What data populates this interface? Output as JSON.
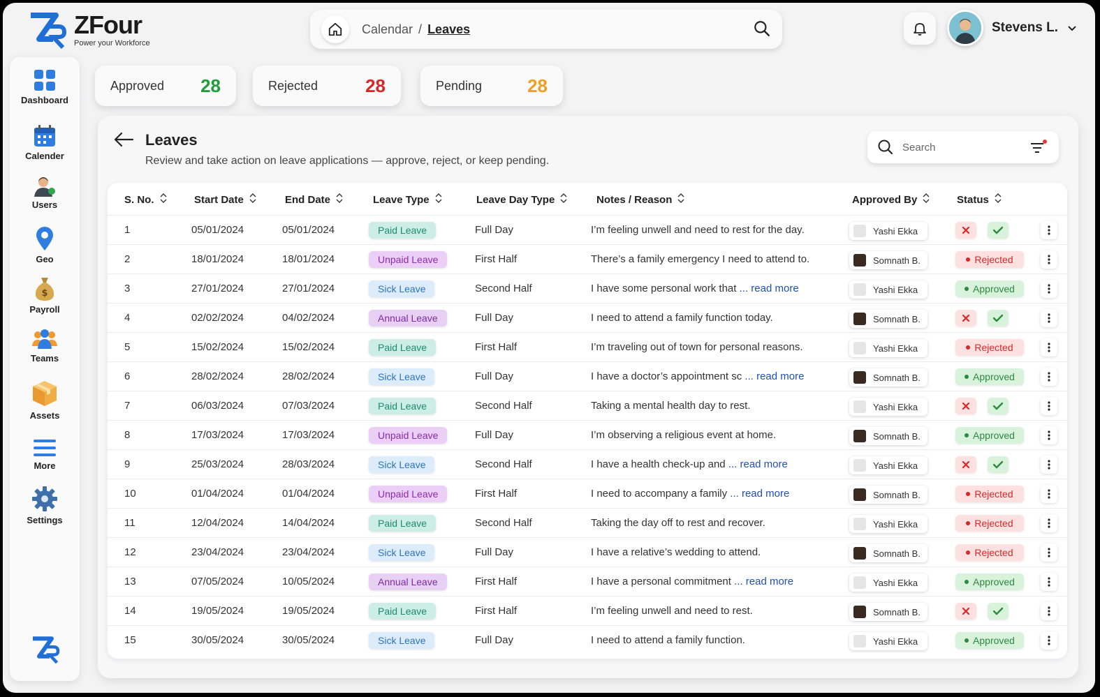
{
  "brand": {
    "name": "ZFour",
    "tagline": "Power your Workforce"
  },
  "breadcrumb": {
    "parent": "Calendar",
    "separator": "/",
    "current": "Leaves"
  },
  "user": {
    "name": "Stevens L."
  },
  "sidebar": {
    "items": [
      {
        "label": "Dashboard",
        "icon": "dashboard-icon"
      },
      {
        "label": "Calender",
        "icon": "calendar-icon"
      },
      {
        "label": "Users",
        "icon": "users-icon"
      },
      {
        "label": "Geo",
        "icon": "geo-pin-icon"
      },
      {
        "label": "Payroll",
        "icon": "money-bag-icon"
      },
      {
        "label": "Teams",
        "icon": "teams-icon"
      },
      {
        "label": "Assets",
        "icon": "box-icon"
      },
      {
        "label": "More",
        "icon": "menu-icon"
      },
      {
        "label": "Settings",
        "icon": "gear-icon"
      }
    ]
  },
  "stats": [
    {
      "label": "Approved",
      "value": "28",
      "color": "#1f9d3a"
    },
    {
      "label": "Rejected",
      "value": "28",
      "color": "#d62828"
    },
    {
      "label": "Pending",
      "value": "28",
      "color": "#f0a020"
    }
  ],
  "panel": {
    "title": "Leaves",
    "subtitle": "Review and take action on leave applications — approve, reject, or keep pending.",
    "search_placeholder": "Search"
  },
  "table": {
    "columns": [
      "S. No.",
      "Start Date",
      "End Date",
      "Leave Type",
      "Leave Day Type",
      "Notes / Reason",
      "Approved By",
      "Status"
    ],
    "rows": [
      {
        "no": "1",
        "start": "05/01/2024",
        "end": "05/01/2024",
        "type": "Paid Leave",
        "type_class": "paid",
        "day": "Full Day",
        "note": "I’m feeling unwell and need to rest for the day.",
        "more": "",
        "approver": "Yashi Ekka",
        "avatar": "light",
        "status": "pending"
      },
      {
        "no": "2",
        "start": "18/01/2024",
        "end": "18/01/2024",
        "type": "Unpaid Leave",
        "type_class": "unpaid",
        "day": "First Half",
        "note": "There’s a family emergency I need to attend to.",
        "more": "",
        "approver": "Somnath B.",
        "avatar": "dark",
        "status": "Rejected"
      },
      {
        "no": "3",
        "start": "27/01/2024",
        "end": "27/01/2024",
        "type": "Sick Leave",
        "type_class": "sick",
        "day": "Second Half",
        "note": "I have some personal work that",
        "more": "... read more",
        "approver": "Yashi Ekka",
        "avatar": "light",
        "status": "Approved"
      },
      {
        "no": "4",
        "start": "02/02/2024",
        "end": "04/02/2024",
        "type": "Annual Leave",
        "type_class": "annual",
        "day": "Full Day",
        "note": "I need to attend a family function today.",
        "more": "",
        "approver": "Somnath B.",
        "avatar": "dark",
        "status": "pending"
      },
      {
        "no": "5",
        "start": "15/02/2024",
        "end": "15/02/2024",
        "type": "Paid Leave",
        "type_class": "paid",
        "day": "First Half",
        "note": "I’m traveling out of town for personal reasons.",
        "more": "",
        "approver": "Yashi Ekka",
        "avatar": "light",
        "status": "Rejected"
      },
      {
        "no": "6",
        "start": "28/02/2024",
        "end": "28/02/2024",
        "type": "Sick Leave",
        "type_class": "sick",
        "day": "Full Day",
        "note": "I have a doctor’s appointment sc",
        "more": "... read more",
        "approver": "Somnath B.",
        "avatar": "dark",
        "status": "Approved"
      },
      {
        "no": "7",
        "start": "06/03/2024",
        "end": "07/03/2024",
        "type": "Paid Leave",
        "type_class": "paid",
        "day": "Second Half",
        "note": "Taking a mental health day to rest.",
        "more": "",
        "approver": "Yashi Ekka",
        "avatar": "light",
        "status": "pending"
      },
      {
        "no": "8",
        "start": "17/03/2024",
        "end": "17/03/2024",
        "type": "Unpaid Leave",
        "type_class": "unpaid",
        "day": "Full Day",
        "note": "I’m observing a religious event at home.",
        "more": "",
        "approver": "Somnath B.",
        "avatar": "dark",
        "status": "Approved"
      },
      {
        "no": "9",
        "start": "25/03/2024",
        "end": "28/03/2024",
        "type": "Sick Leave",
        "type_class": "sick",
        "day": "Second Half",
        "note": "I have a health check-up and",
        "more": "... read more",
        "approver": "Yashi Ekka",
        "avatar": "light",
        "status": "pending"
      },
      {
        "no": "10",
        "start": "01/04/2024",
        "end": "01/04/2024",
        "type": "Unpaid Leave",
        "type_class": "unpaid",
        "day": "First Half",
        "note": "I need to accompany a family",
        "more": "... read more",
        "approver": "Somnath B.",
        "avatar": "dark",
        "status": "Rejected"
      },
      {
        "no": "11",
        "start": "12/04/2024",
        "end": "14/04/2024",
        "type": "Paid Leave",
        "type_class": "paid",
        "day": "Second Half",
        "note": "Taking the day off to rest and recover.",
        "more": "",
        "approver": "Yashi Ekka",
        "avatar": "light",
        "status": "Rejected"
      },
      {
        "no": "12",
        "start": "23/04/2024",
        "end": "23/04/2024",
        "type": "Sick Leave",
        "type_class": "sick",
        "day": "Full Day",
        "note": "I have a relative’s wedding to attend.",
        "more": "",
        "approver": "Somnath B.",
        "avatar": "dark",
        "status": "Rejected"
      },
      {
        "no": "13",
        "start": "07/05/2024",
        "end": "10/05/2024",
        "type": "Annual Leave",
        "type_class": "annual",
        "day": "First Half",
        "note": "I have a personal commitment",
        "more": "... read more",
        "approver": "Yashi Ekka",
        "avatar": "light",
        "status": "Approved"
      },
      {
        "no": "14",
        "start": "19/05/2024",
        "end": "19/05/2024",
        "type": "Paid Leave",
        "type_class": "paid",
        "day": "First Half",
        "note": "I’m feeling unwell and need to rest.",
        "more": "",
        "approver": "Somnath B.",
        "avatar": "dark",
        "status": "pending"
      },
      {
        "no": "15",
        "start": "30/05/2024",
        "end": "30/05/2024",
        "type": "Sick Leave",
        "type_class": "sick",
        "day": "Full Day",
        "note": "I need to attend a family function.",
        "more": "",
        "approver": "Yashi Ekka",
        "avatar": "light",
        "status": "Approved"
      }
    ]
  }
}
